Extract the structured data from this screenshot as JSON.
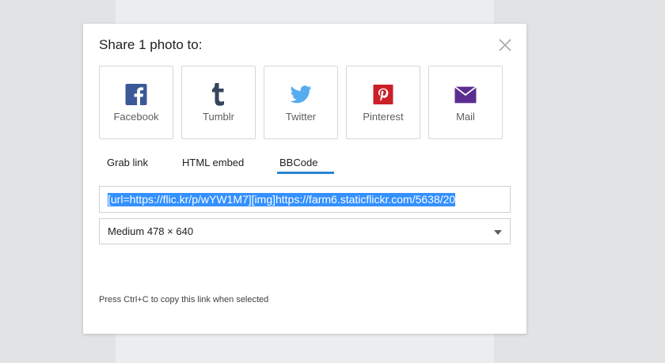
{
  "dialog": {
    "title": "Share 1 photo to:"
  },
  "share_targets": [
    {
      "label": "Facebook",
      "icon": "facebook-icon",
      "color": "#3b5998"
    },
    {
      "label": "Tumblr",
      "icon": "tumblr-icon",
      "color": "#35465c"
    },
    {
      "label": "Twitter",
      "icon": "twitter-icon",
      "color": "#55acee"
    },
    {
      "label": "Pinterest",
      "icon": "pinterest-icon",
      "color": "#cb2027"
    },
    {
      "label": "Mail",
      "icon": "mail-icon",
      "color": "#5c2d91"
    }
  ],
  "tabs": [
    {
      "label": "Grab link",
      "active": false
    },
    {
      "label": "HTML embed",
      "active": false
    },
    {
      "label": "BBCode",
      "active": true
    }
  ],
  "accent_color": "#2b84d1",
  "link_field": {
    "value": "[url=https://flic.kr/p/wYW1M7][img]https://farm6.staticflickr.com/5638/20"
  },
  "size_select": {
    "selected": "Medium 478 × 640"
  },
  "hint": "Press Ctrl+C to copy this link when selected"
}
